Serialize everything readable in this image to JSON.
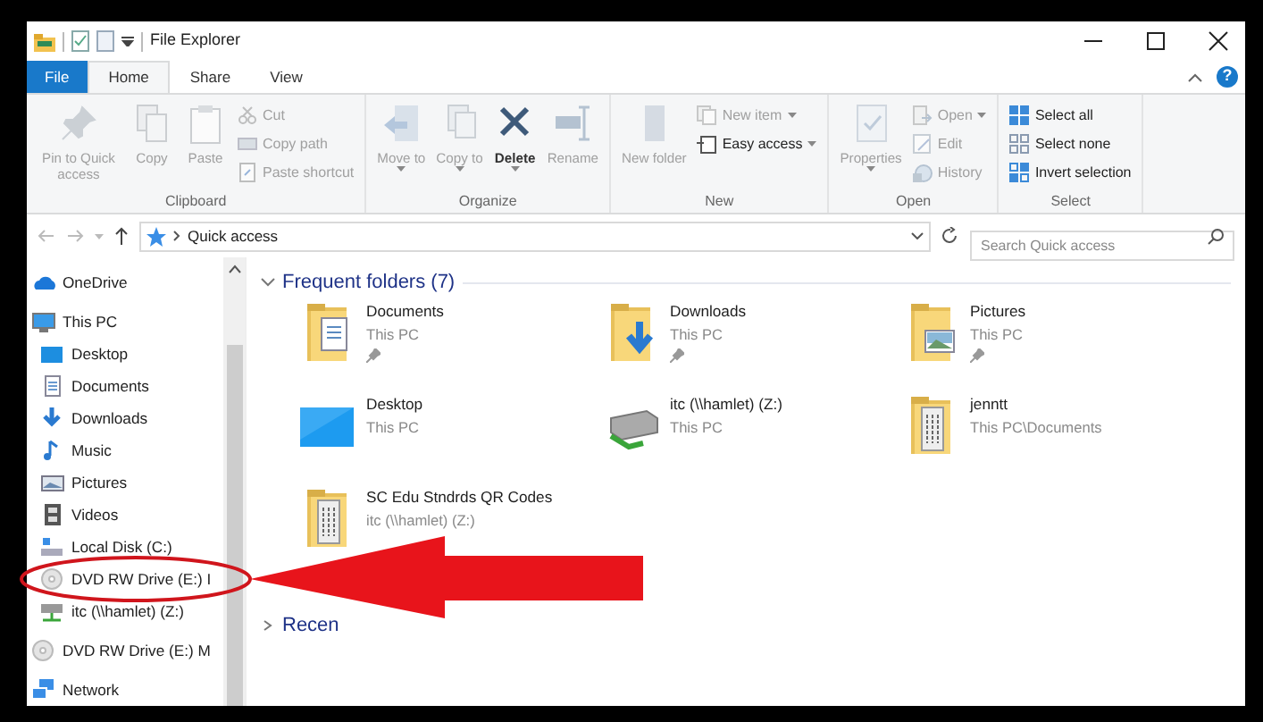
{
  "window": {
    "title": "File Explorer",
    "help": "?"
  },
  "ribbon": {
    "tabs": [
      {
        "label": "File",
        "kind": "file",
        "selected": false
      },
      {
        "label": "Home",
        "kind": "tab",
        "selected": true
      },
      {
        "label": "Share",
        "kind": "tab",
        "selected": false
      },
      {
        "label": "View",
        "kind": "tab",
        "selected": false
      }
    ],
    "groups": [
      {
        "label": "Clipboard",
        "commands": [
          {
            "label": "Pin to Quick access",
            "kind": "large",
            "disabled": true,
            "dropdown": false
          },
          {
            "label": "Copy",
            "kind": "large",
            "disabled": true,
            "dropdown": false
          },
          {
            "label": "Paste",
            "kind": "large",
            "disabled": true,
            "dropdown": false
          },
          {
            "label": "Cut",
            "kind": "small",
            "disabled": true,
            "dropdown": false
          },
          {
            "label": "Copy path",
            "kind": "small",
            "disabled": true,
            "dropdown": false
          },
          {
            "label": "Paste shortcut",
            "kind": "small",
            "disabled": true,
            "dropdown": false
          }
        ]
      },
      {
        "label": "Organize",
        "commands": [
          {
            "label": "Move to",
            "kind": "large",
            "disabled": true,
            "dropdown": true
          },
          {
            "label": "Copy to",
            "kind": "large",
            "disabled": true,
            "dropdown": true
          },
          {
            "label": "Delete",
            "kind": "large",
            "disabled": false,
            "dropdown": true
          },
          {
            "label": "Rename",
            "kind": "large",
            "disabled": true,
            "dropdown": false
          }
        ]
      },
      {
        "label": "New",
        "commands": [
          {
            "label": "New folder",
            "kind": "large",
            "disabled": true,
            "dropdown": false
          },
          {
            "label": "New item",
            "kind": "small",
            "disabled": true,
            "dropdown": true
          },
          {
            "label": "Easy access",
            "kind": "small",
            "disabled": false,
            "dropdown": true
          }
        ]
      },
      {
        "label": "Open",
        "commands": [
          {
            "label": "Properties",
            "kind": "large",
            "disabled": true,
            "dropdown": true
          },
          {
            "label": "Open",
            "kind": "small",
            "disabled": true,
            "dropdown": true
          },
          {
            "label": "Edit",
            "kind": "small",
            "disabled": true,
            "dropdown": false
          },
          {
            "label": "History",
            "kind": "small",
            "disabled": true,
            "dropdown": false
          }
        ]
      },
      {
        "label": "Select",
        "commands": [
          {
            "label": "Select all",
            "kind": "small",
            "disabled": false,
            "dropdown": false
          },
          {
            "label": "Select none",
            "kind": "small",
            "disabled": false,
            "dropdown": false
          },
          {
            "label": "Invert selection",
            "kind": "small",
            "disabled": false,
            "dropdown": false
          }
        ]
      }
    ]
  },
  "address": {
    "path": "Quick access",
    "search_placeholder": "Search Quick access"
  },
  "sidebar": {
    "items": [
      {
        "label": "OneDrive",
        "kind": "cloud"
      },
      {
        "label": "This PC",
        "kind": "pc",
        "children": [
          {
            "label": "Desktop",
            "kind": "desktop"
          },
          {
            "label": "Documents",
            "kind": "documents"
          },
          {
            "label": "Downloads",
            "kind": "downloads"
          },
          {
            "label": "Music",
            "kind": "music"
          },
          {
            "label": "Pictures",
            "kind": "pictures"
          },
          {
            "label": "Videos",
            "kind": "videos"
          },
          {
            "label": "Local Disk (C:)",
            "kind": "disk"
          },
          {
            "label": "DVD RW Drive (E:) I",
            "kind": "dvd"
          },
          {
            "label": "itc (\\\\hamlet) (Z:)",
            "kind": "netdrive"
          }
        ]
      },
      {
        "label": "DVD RW Drive (E:) M",
        "kind": "dvd"
      },
      {
        "label": "Network",
        "kind": "network"
      }
    ]
  },
  "sections": [
    {
      "title": "Frequent folders (7)",
      "expanded": true,
      "items": [
        {
          "name": "Documents",
          "location": "This PC",
          "pinned": true,
          "kind": "documents"
        },
        {
          "name": "Downloads",
          "location": "This PC",
          "pinned": true,
          "kind": "downloads"
        },
        {
          "name": "Pictures",
          "location": "This PC",
          "pinned": true,
          "kind": "pictures"
        },
        {
          "name": "Desktop",
          "location": "This PC",
          "pinned": false,
          "kind": "desktop"
        },
        {
          "name": "itc (\\\\hamlet) (Z:)",
          "location": "This PC",
          "pinned": false,
          "kind": "netdrive"
        },
        {
          "name": "jenntt",
          "location": "This PC\\Documents",
          "pinned": false,
          "kind": "papers"
        },
        {
          "name": "SC Edu Stndrds QR Codes",
          "location": "itc (\\\\hamlet) (Z:)",
          "pinned": false,
          "kind": "papers"
        }
      ]
    },
    {
      "title": "Recen",
      "expanded": false
    }
  ]
}
